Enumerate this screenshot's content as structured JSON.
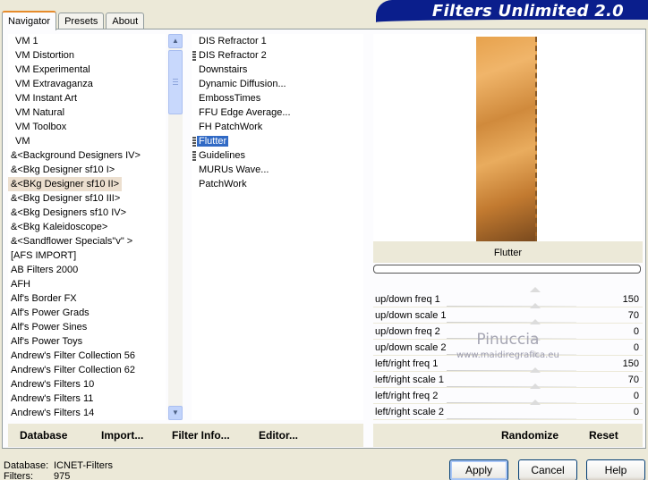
{
  "tabs": [
    {
      "label": "Navigator",
      "active": true
    },
    {
      "label": "Presets",
      "active": false
    },
    {
      "label": "About",
      "active": false
    }
  ],
  "banner_title": "Filters Unlimited 2.0",
  "categories": [
    {
      "label": "VM 1"
    },
    {
      "label": "VM Distortion"
    },
    {
      "label": "VM Experimental"
    },
    {
      "label": "VM Extravaganza"
    },
    {
      "label": "VM Instant Art"
    },
    {
      "label": "VM Natural"
    },
    {
      "label": "VM Toolbox"
    },
    {
      "label": "VM"
    },
    {
      "label": "&<Background Designers IV>"
    },
    {
      "label": "&<Bkg Designer sf10 I>"
    },
    {
      "label": "&<BKg Designer sf10 II>",
      "selected": true
    },
    {
      "label": "&<Bkg Designer sf10 III>"
    },
    {
      "label": "&<Bkg Designers sf10 IV>"
    },
    {
      "label": "&<Bkg Kaleidoscope>"
    },
    {
      "label": "&<Sandflower Specials\"v\" >"
    },
    {
      "label": "[AFS IMPORT]"
    },
    {
      "label": "AB Filters 2000"
    },
    {
      "label": "AFH"
    },
    {
      "label": "Alf's Border FX"
    },
    {
      "label": "Alf's Power Grads"
    },
    {
      "label": "Alf's Power Sines"
    },
    {
      "label": "Alf's Power Toys"
    },
    {
      "label": "Andrew's Filter Collection 56"
    },
    {
      "label": "Andrew's Filter Collection 62"
    },
    {
      "label": "Andrew's Filters 10"
    },
    {
      "label": "Andrew's Filters 11"
    },
    {
      "label": "Andrew's Filters 14"
    }
  ],
  "filters": [
    {
      "label": "DIS Refractor 1",
      "marked": false
    },
    {
      "label": "DIS Refractor 2",
      "marked": true
    },
    {
      "label": "Downstairs",
      "marked": false
    },
    {
      "label": "Dynamic Diffusion...",
      "marked": false
    },
    {
      "label": "EmbossTimes",
      "marked": false
    },
    {
      "label": "FFU Edge Average...",
      "marked": false
    },
    {
      "label": "FH PatchWork",
      "marked": false
    },
    {
      "label": "Flutter",
      "marked": true,
      "selected": true
    },
    {
      "label": "Guidelines",
      "marked": true
    },
    {
      "label": "MURUs Wave...",
      "marked": false
    },
    {
      "label": "PatchWork",
      "marked": false
    }
  ],
  "preview_name": "Flutter",
  "params": [
    {
      "label": "up/down freq 1",
      "value": "150"
    },
    {
      "label": "up/down scale 1",
      "value": "70"
    },
    {
      "label": "up/down freq 2",
      "value": "0"
    },
    {
      "label": "up/down scale 2",
      "value": "0"
    },
    {
      "label": "left/right freq 1",
      "value": "150"
    },
    {
      "label": "left/right scale 1",
      "value": "70"
    },
    {
      "label": "left/right freq 2",
      "value": "0"
    },
    {
      "label": "left/right scale 2",
      "value": "0"
    }
  ],
  "watermark": {
    "line1": "Pinuccia",
    "line2": "www.maidiregrafica.eu"
  },
  "left_buttons": {
    "database": "Database",
    "import": "Import...",
    "filter_info": "Filter Info...",
    "editor": "Editor..."
  },
  "right_buttons": {
    "randomize": "Randomize",
    "reset": "Reset"
  },
  "status": {
    "database_label": "Database:",
    "database_value": "ICNET-Filters",
    "filters_label": "Filters:",
    "filters_value": "975"
  },
  "dialog_buttons": {
    "apply": "Apply",
    "cancel": "Cancel",
    "help": "Help"
  },
  "colors": {
    "selection": "#316ac5",
    "banner": "#0a1e8c",
    "panel": "#ece9d8"
  }
}
